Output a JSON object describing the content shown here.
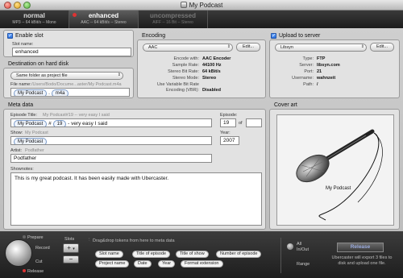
{
  "window": {
    "title": "My Podcast"
  },
  "tabs": [
    {
      "name": "normal",
      "sub": "MP3 -- 64 kBit/s -- Mono"
    },
    {
      "name": "enhanced",
      "sub": "AAC -- 64 kBit/s -- Stereo"
    },
    {
      "name": "uncompressed",
      "sub": "AIFF -- 16 Bit -- Stereo"
    }
  ],
  "slot": {
    "enable_label": "Enable slot",
    "name_label": "Slot name:",
    "name_value": "enhanced"
  },
  "destination": {
    "title": "Destination on hard disk",
    "folder_option": "Same folder as project file",
    "file_label": "File name:",
    "file_path": "/Users/Bodo/Docume...aster/My Podcast.m4a",
    "token_name": "My Podcast",
    "ext": "m4a"
  },
  "encoding": {
    "title": "Encoding",
    "format": "AAC",
    "edit_label": "Edit...",
    "rows": [
      {
        "label": "Encode with:",
        "value": "AAC Encoder"
      },
      {
        "label": "Sample Rate:",
        "value": "44100 Hz"
      },
      {
        "label": "Stereo Bit Rate:",
        "value": "64 kBit/s"
      },
      {
        "label": "Stereo Mode:",
        "value": "Stereo"
      },
      {
        "label": "Use Variable Bit Rate Encoding (VBR):",
        "value": "Disabled"
      }
    ]
  },
  "upload": {
    "enable_label": "Upload to server",
    "server": "Libsyn",
    "edit_label": "Edit...",
    "rows": [
      {
        "label": "Type:",
        "value": "FTP"
      },
      {
        "label": "Server:",
        "value": "libsyn.com"
      },
      {
        "label": "Port:",
        "value": "21"
      },
      {
        "label": "Username:",
        "value": "wahnzeit"
      },
      {
        "label": "Path:",
        "value": "/"
      }
    ]
  },
  "meta": {
    "title": "Meta data",
    "episode_title_label": "Episode Title:",
    "episode_title_hint": "My Podcast#19 -- very easy I said",
    "title_token": "My Podcast",
    "title_hash": "#",
    "title_episode_token": "19",
    "title_rest": "- very easy I said",
    "episode_label": "Episode:",
    "episode_value": "19",
    "episode_of": "of",
    "episode_total": "",
    "show_label": "Show:",
    "show_hint": "My Podcast",
    "show_token": "My Podcast",
    "year_label": "Year:",
    "year_value": "2007",
    "artist_label": "Artist:",
    "artist_hint": "Podfather",
    "artist_value": "Podfather",
    "shownotes_label": "Shownotes:",
    "shownotes_value": "This is my great podcast. It has been easily made with Ubercaster."
  },
  "cover": {
    "title": "Cover art",
    "caption": "My Podcast"
  },
  "bottom": {
    "prepare": "Prepare",
    "record": "Record",
    "cut": "Cut",
    "release": "Release",
    "slots_label": "Slots",
    "drag_hint": "Drag&drop tokens from here to meta data",
    "tokens_row1": [
      "Slot name",
      "Title of episode",
      "Title of show",
      "Number of episode"
    ],
    "tokens_row2": [
      "Project name",
      "Date",
      "Year",
      "Format extension"
    ],
    "all_label": "All",
    "inout_label": "In/Out",
    "range_label": "Range",
    "release_button": "Release",
    "release_note": "Ubercaster will export 3 files to disk and upload one file."
  },
  "colors": {
    "accent": "#2a6fdc",
    "tab_dot": "#dd3333",
    "release_text": "#99aadd"
  }
}
